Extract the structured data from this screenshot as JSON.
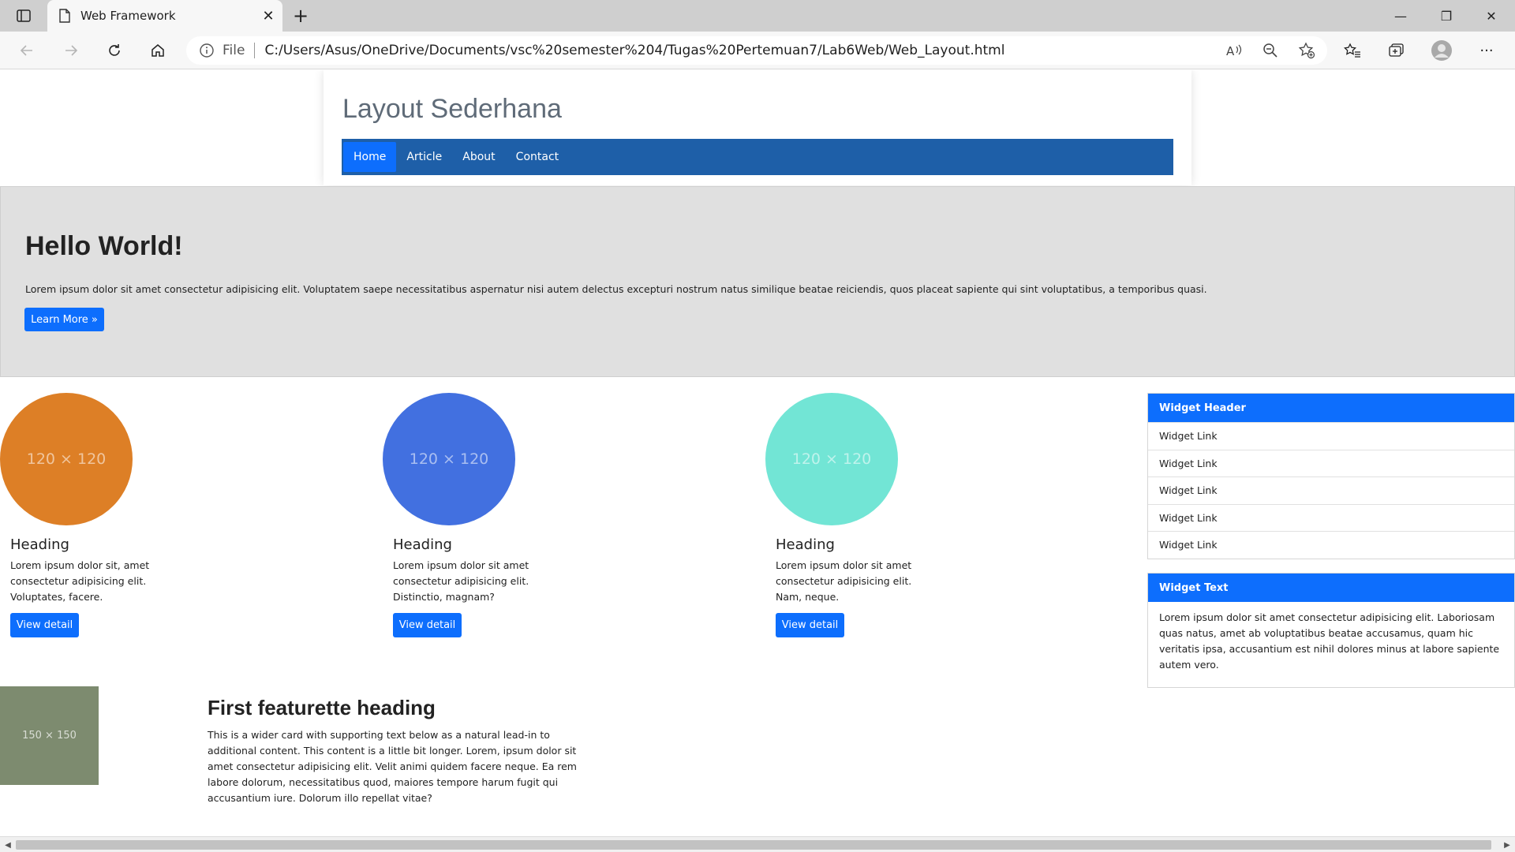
{
  "browser": {
    "tab_title": "Web Framework",
    "tab_close": "✕",
    "new_tab": "+",
    "file_label": "File",
    "url": "C:/Users/Asus/OneDrive/Documents/vsc%20semester%204/Tugas%20Pertemuan7/Lab6Web/Web_Layout.html",
    "minimize": "—",
    "restore": "❐",
    "close": "✕",
    "more": "···"
  },
  "site": {
    "title": "Layout Sederhana",
    "nav": [
      "Home",
      "Article",
      "About",
      "Contact"
    ]
  },
  "hero": {
    "heading": "Hello World!",
    "text": "Lorem ipsum dolor sit amet consectetur adipisicing elit. Voluptatem saepe necessitatibus aspernatur nisi autem delectus excepturi nostrum natus similique beatae reiciendis, quos placeat sapiente qui sint voluptatibus, a temporibus quasi.",
    "button": "Learn More »"
  },
  "columns": [
    {
      "image_label": "120 × 120",
      "color": "#dd7f26",
      "heading": "Heading",
      "text": "Lorem ipsum dolor sit, amet consectetur adipisicing elit. Voluptates, facere.",
      "button": "View detail"
    },
    {
      "image_label": "120 × 120",
      "color": "#4270e0",
      "heading": "Heading",
      "text": "Lorem ipsum dolor sit amet consectetur adipisicing elit. Distinctio, magnam?",
      "button": "View detail"
    },
    {
      "image_label": "120 × 120",
      "color": "#72e5d5",
      "heading": "Heading",
      "text": "Lorem ipsum dolor sit amet consectetur adipisicing elit. Nam, neque.",
      "button": "View detail"
    }
  ],
  "widget1": {
    "header": "Widget Header",
    "links": [
      "Widget Link",
      "Widget Link",
      "Widget Link",
      "Widget Link",
      "Widget Link"
    ]
  },
  "widget2": {
    "header": "Widget Text",
    "text": "Lorem ipsum dolor sit amet consectetur adipisicing elit. Laboriosam quas natus, amet ab voluptatibus beatae accusamus, quam hic veritatis ipsa, accusantium est nihil dolores minus at labore sapiente autem vero."
  },
  "featurette": {
    "image_label": "150 × 150",
    "image_color": "#7d8b6f",
    "heading": "First featurette heading",
    "text": "This is a wider card with supporting text below as a natural lead-in to additional content. This content is a little bit longer. Lorem, ipsum dolor sit amet consectetur adipisicing elit. Velit animi quidem facere neque. Ea rem labore dolorum, necessitatibus quod, maiores tempore harum fugit qui accusantium iure. Dolorum illo repellat vitae?"
  },
  "colors": {
    "primary": "#0d6efd",
    "navbar": "#1e5fa8",
    "hero_bg": "#e0e0e0"
  },
  "icons": [
    "sidebar-toggle-icon",
    "document-icon",
    "back-icon",
    "forward-icon",
    "refresh-icon",
    "home-icon",
    "info-icon",
    "read-aloud-icon",
    "zoom-out-icon",
    "add-favorite-icon",
    "favorites-icon",
    "collections-icon",
    "profile-icon",
    "more-icon"
  ]
}
